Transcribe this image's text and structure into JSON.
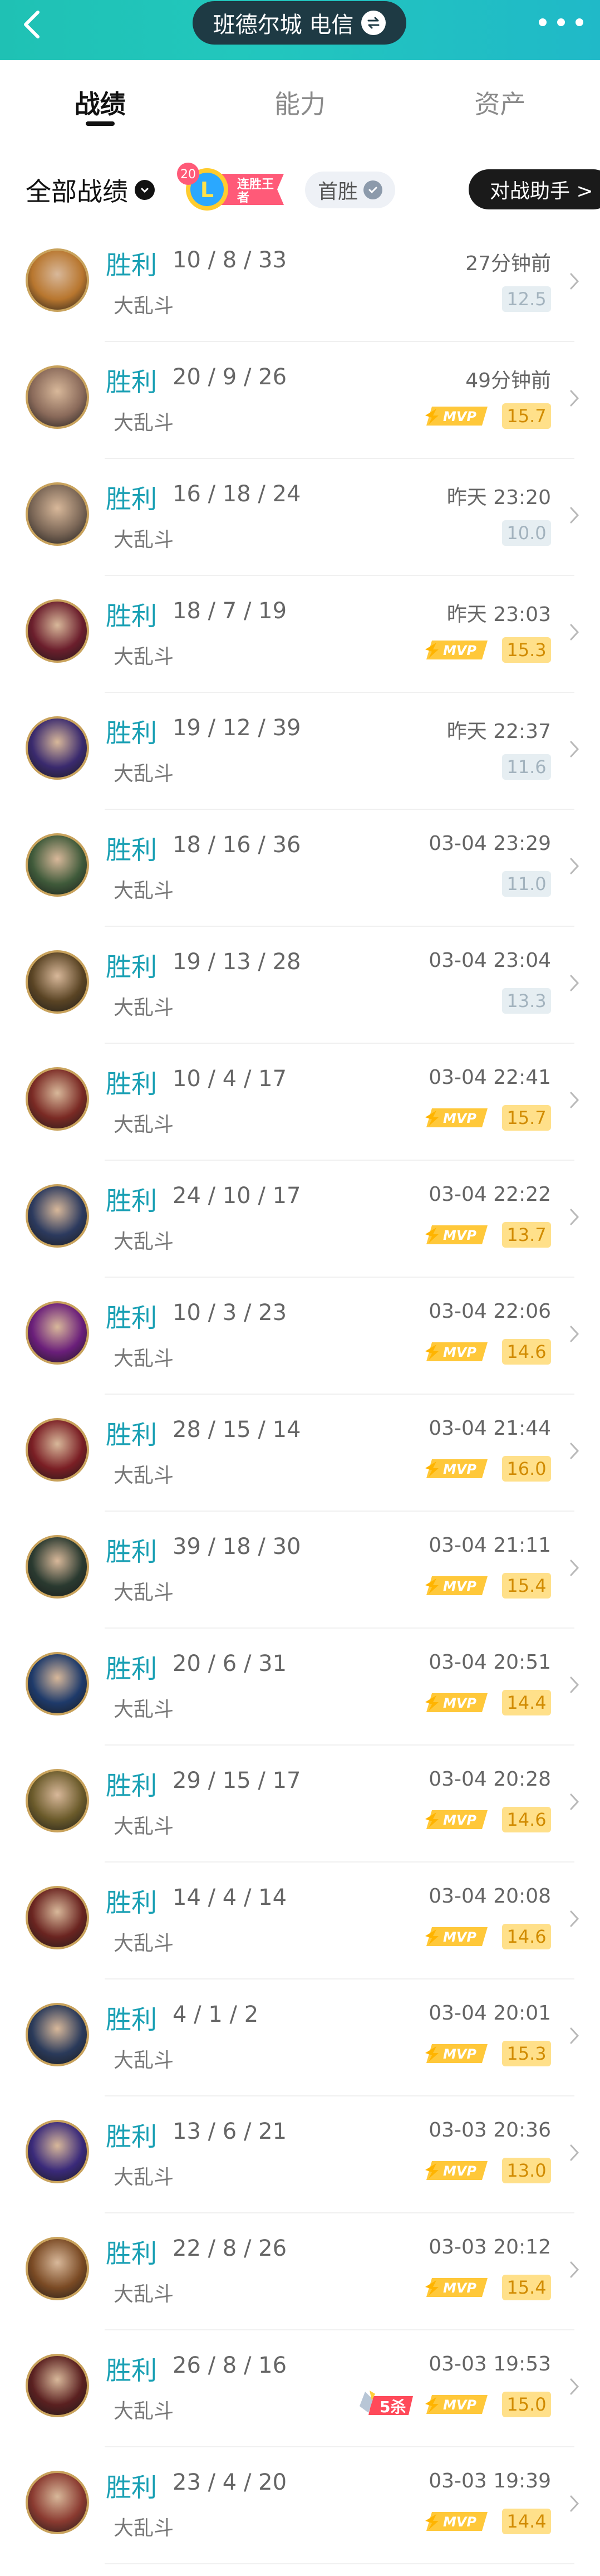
{
  "header": {
    "server": "班德尔城 电信"
  },
  "tabs": [
    "战绩",
    "能力",
    "资产"
  ],
  "filter": {
    "all_label": "全部战绩",
    "badge_level": "20",
    "badge_letter": "L",
    "badge_text": "连胜王者",
    "first_win": "首胜",
    "assistant": "对战助手 >"
  },
  "colors": {
    "accent": "#1fc1b4",
    "win": "#1aa0b4",
    "mvp_bg": "#ffe08a",
    "mvp_fg": "#d18b00"
  },
  "matches": [
    {
      "result": "胜利",
      "kda": "10 / 8 / 33",
      "mode": "大乱斗",
      "time": "27分钟前",
      "score": "12.5",
      "mvp": false,
      "kill5": false,
      "avatar": "#b8762e"
    },
    {
      "result": "胜利",
      "kda": "20 / 9 / 26",
      "mode": "大乱斗",
      "time": "49分钟前",
      "score": "15.7",
      "mvp": true,
      "kill5": false,
      "avatar": "#8a6a5a"
    },
    {
      "result": "胜利",
      "kda": "16 / 18 / 24",
      "mode": "大乱斗",
      "time": "昨天 23:20",
      "score": "10.0",
      "mvp": false,
      "kill5": false,
      "avatar": "#7a6656"
    },
    {
      "result": "胜利",
      "kda": "18 / 7 / 19",
      "mode": "大乱斗",
      "time": "昨天 23:03",
      "score": "15.3",
      "mvp": true,
      "kill5": false,
      "avatar": "#6b1e2c"
    },
    {
      "result": "胜利",
      "kda": "19 / 12 / 39",
      "mode": "大乱斗",
      "time": "昨天 22:37",
      "score": "11.6",
      "mvp": false,
      "kill5": false,
      "avatar": "#3a2a6e"
    },
    {
      "result": "胜利",
      "kda": "18 / 16 / 36",
      "mode": "大乱斗",
      "time": "03-04 23:29",
      "score": "11.0",
      "mvp": false,
      "kill5": false,
      "avatar": "#3f5a3a"
    },
    {
      "result": "胜利",
      "kda": "19 / 13 / 28",
      "mode": "大乱斗",
      "time": "03-04 23:04",
      "score": "13.3",
      "mvp": false,
      "kill5": false,
      "avatar": "#5a4424"
    },
    {
      "result": "胜利",
      "kda": "10 / 4 / 17",
      "mode": "大乱斗",
      "time": "03-04 22:41",
      "score": "15.7",
      "mvp": true,
      "kill5": false,
      "avatar": "#7a2a24"
    },
    {
      "result": "胜利",
      "kda": "24 / 10 / 17",
      "mode": "大乱斗",
      "time": "03-04 22:22",
      "score": "13.7",
      "mvp": true,
      "kill5": false,
      "avatar": "#2c3a5e"
    },
    {
      "result": "胜利",
      "kda": "10 / 3 / 23",
      "mode": "大乱斗",
      "time": "03-04 22:06",
      "score": "14.6",
      "mvp": true,
      "kill5": false,
      "avatar": "#6a1e7a"
    },
    {
      "result": "胜利",
      "kda": "28 / 15 / 14",
      "mode": "大乱斗",
      "time": "03-04 21:44",
      "score": "16.0",
      "mvp": true,
      "kill5": false,
      "avatar": "#7a1e24"
    },
    {
      "result": "胜利",
      "kda": "39 / 18 / 30",
      "mode": "大乱斗",
      "time": "03-04 21:11",
      "score": "15.4",
      "mvp": true,
      "kill5": false,
      "avatar": "#2a3a30"
    },
    {
      "result": "胜利",
      "kda": "20 / 6 / 31",
      "mode": "大乱斗",
      "time": "03-04 20:51",
      "score": "14.4",
      "mvp": true,
      "kill5": false,
      "avatar": "#1e3a6a"
    },
    {
      "result": "胜利",
      "kda": "29 / 15 / 17",
      "mode": "大乱斗",
      "time": "03-04 20:28",
      "score": "14.6",
      "mvp": true,
      "kill5": false,
      "avatar": "#6a5a2a"
    },
    {
      "result": "胜利",
      "kda": "14 / 4 / 14",
      "mode": "大乱斗",
      "time": "03-04 20:08",
      "score": "14.6",
      "mvp": true,
      "kill5": false,
      "avatar": "#6a2420"
    },
    {
      "result": "胜利",
      "kda": "4 / 1 / 2",
      "mode": "大乱斗",
      "time": "03-04 20:01",
      "score": "15.3",
      "mvp": true,
      "kill5": false,
      "avatar": "#2a3a5a"
    },
    {
      "result": "胜利",
      "kda": "13 / 6 / 21",
      "mode": "大乱斗",
      "time": "03-03 20:36",
      "score": "13.0",
      "mvp": true,
      "kill5": false,
      "avatar": "#3a2a7a"
    },
    {
      "result": "胜利",
      "kda": "22 / 8 / 26",
      "mode": "大乱斗",
      "time": "03-03 20:12",
      "score": "15.4",
      "mvp": true,
      "kill5": false,
      "avatar": "#7a4a24"
    },
    {
      "result": "胜利",
      "kda": "26 / 8 / 16",
      "mode": "大乱斗",
      "time": "03-03 19:53",
      "score": "15.0",
      "mvp": true,
      "kill5": true,
      "kill5_label": "5杀",
      "avatar": "#5a2020"
    },
    {
      "result": "胜利",
      "kda": "23 / 4 / 20",
      "mode": "大乱斗",
      "time": "03-03 19:39",
      "score": "14.4",
      "mvp": true,
      "kill5": false,
      "avatar": "#8a3a30"
    }
  ]
}
